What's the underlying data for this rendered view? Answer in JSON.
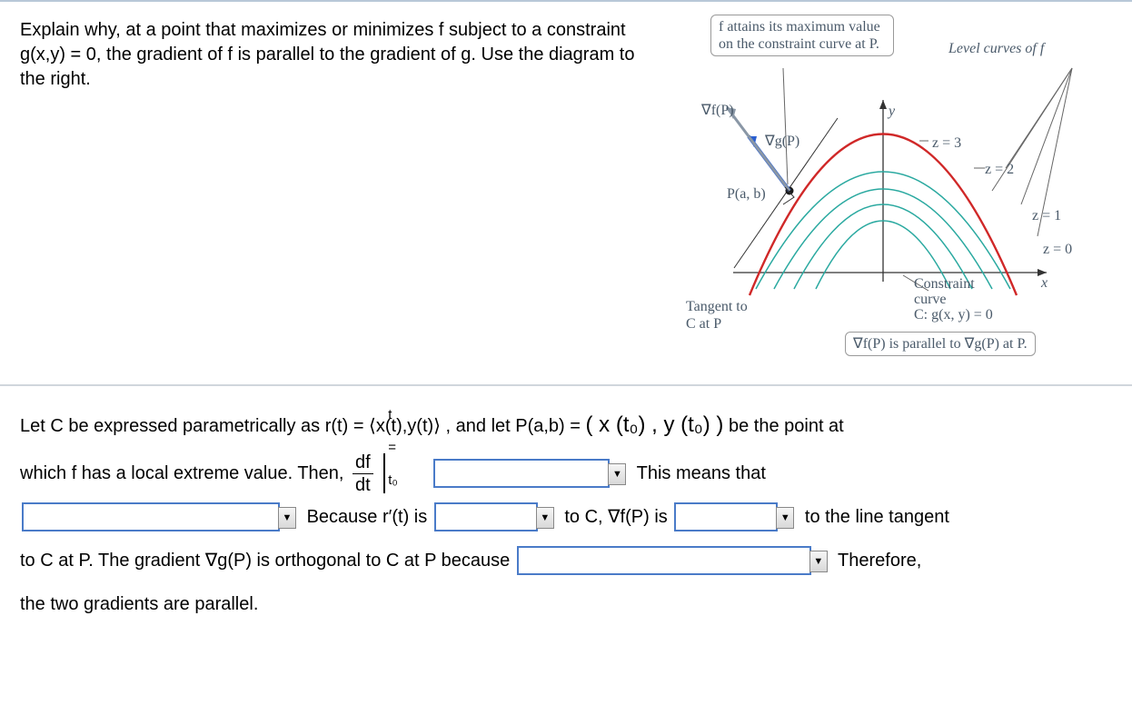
{
  "question": {
    "text": "Explain why, at a point that maximizes or minimizes f subject to a constraint g(x,y) = 0, the gradient of f is parallel to the gradient of g. Use the diagram to the right."
  },
  "diagram": {
    "callout_top": "f attains its maximum value on the constraint curve at P.",
    "level_curves_label": "Level curves of f",
    "grad_f_label": "∇f(P)",
    "grad_g_label": "∇g(P)",
    "point_label": "P(a, b)",
    "y_axis": "y",
    "x_axis": "x",
    "z_labels": [
      "z = 3",
      "z = 2",
      "z = 1",
      "z = 0"
    ],
    "tangent_label": "Tangent to C at P",
    "constraint_label_line1": "Constraint",
    "constraint_label_line2": "curve",
    "constraint_label_line3": "C: g(x, y) = 0",
    "callout_bottom": "∇f(P) is parallel to ∇g(P) at P."
  },
  "solution": {
    "para_lead": "Let C be expressed parametrically as ",
    "rt_def": "r(t) = ⟨x(t),y(t)⟩",
    "and_let": ", and let P(a,b) = ",
    "p_def": "( x (t₀) , y (t₀) )",
    "be_point": " be the point at",
    "line2_a": "which f has a local extreme value. Then, ",
    "frac_num": "df",
    "frac_den": "dt",
    "eval_sub": "t = t₀",
    "line2_c": "This means that",
    "line3_b": "Because r′(t) is",
    "line3_c": "to C, ∇f(P) is",
    "line3_d": "to the line tangent",
    "line4_a": "to C at P. The gradient ∇g(P) is orthogonal to C at P because",
    "line4_b": "Therefore,",
    "line5": "the two gradients are parallel."
  }
}
